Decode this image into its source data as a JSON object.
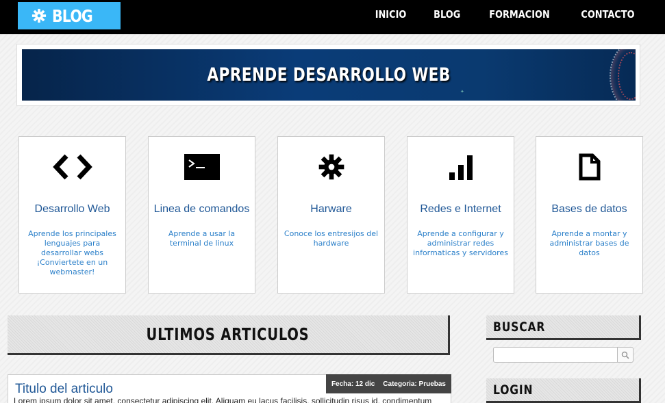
{
  "header": {
    "logo_text": "BLOG",
    "logo_icon": "gear-icon",
    "nav": [
      "INICIO",
      "BLOG",
      "FORMACION",
      "CONTACTO"
    ]
  },
  "banner": {
    "title": "APRENDE DESARROLLO WEB"
  },
  "cards": [
    {
      "icon": "code-icon",
      "title": "Desarrollo Web",
      "desc": "Aprende los principales lenguajes para desarrollar webs ¡Conviertete en un webmaster!"
    },
    {
      "icon": "terminal-icon",
      "title": "Linea de comandos",
      "desc": "Aprende a usar la terminal de linux"
    },
    {
      "icon": "gear-icon",
      "title": "Harware",
      "desc": "Conoce los entresijos del hardware"
    },
    {
      "icon": "signal-bars-icon",
      "title": "Redes e Internet",
      "desc": "Aprende a configurar y administrar redes informaticas y servidores"
    },
    {
      "icon": "document-icon",
      "title": "Bases de datos",
      "desc": "Aprende a montar y administrar bases de datos"
    }
  ],
  "articles_section": {
    "title": "ULTIMOS ARTICULOS"
  },
  "article": {
    "title": "Titulo del articulo",
    "date": "Fecha: 12 dic",
    "category": "Categoria: Pruebas",
    "excerpt": "Lorem ipsum dolor sit amet, consectetur adipiscing elit. Aliquam eu lacus facilisis, sollicitudin risus id, condimentum"
  },
  "sidebar": {
    "search_title": "BUSCAR",
    "search_value": "",
    "search_icon": "search-icon",
    "login_title": "LOGIN"
  },
  "colors": {
    "accent": "#3ab7f7",
    "link": "#1f5796",
    "text_blue": "#2a7fc9",
    "topbar": "#000000"
  }
}
